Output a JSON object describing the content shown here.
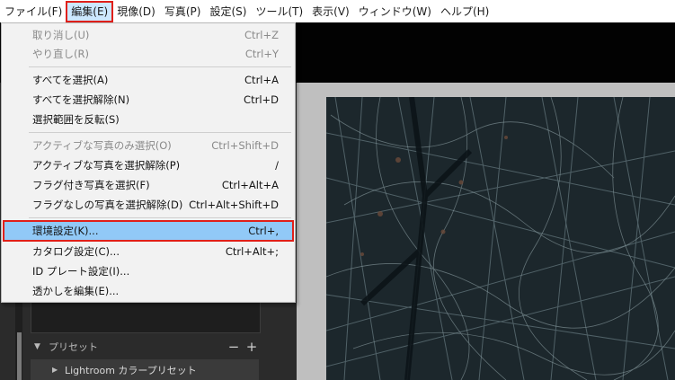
{
  "menubar": {
    "items": [
      {
        "label": "ファイル(F)"
      },
      {
        "label": "編集(E)"
      },
      {
        "label": "現像(D)"
      },
      {
        "label": "写真(P)"
      },
      {
        "label": "設定(S)"
      },
      {
        "label": "ツール(T)"
      },
      {
        "label": "表示(V)"
      },
      {
        "label": "ウィンドウ(W)"
      },
      {
        "label": "ヘルプ(H)"
      }
    ],
    "active_item": "編集(E)"
  },
  "edit_menu": {
    "groups": [
      [
        {
          "label": "取り消し(U)",
          "shortcut": "Ctrl+Z",
          "enabled": false
        },
        {
          "label": "やり直し(R)",
          "shortcut": "Ctrl+Y",
          "enabled": false
        }
      ],
      [
        {
          "label": "すべてを選択(A)",
          "shortcut": "Ctrl+A",
          "enabled": true
        },
        {
          "label": "すべてを選択解除(N)",
          "shortcut": "Ctrl+D",
          "enabled": true
        },
        {
          "label": "選択範囲を反転(S)",
          "shortcut": "",
          "enabled": true
        }
      ],
      [
        {
          "label": "アクティブな写真のみ選択(O)",
          "shortcut": "Ctrl+Shift+D",
          "enabled": false
        },
        {
          "label": "アクティブな写真を選択解除(P)",
          "shortcut": "/",
          "enabled": true
        },
        {
          "label": "フラグ付き写真を選択(F)",
          "shortcut": "Ctrl+Alt+A",
          "enabled": true
        },
        {
          "label": "フラグなしの写真を選択解除(D)",
          "shortcut": "Ctrl+Alt+Shift+D",
          "enabled": true
        }
      ],
      [
        {
          "label": "環境設定(K)...",
          "shortcut": "Ctrl+,",
          "enabled": true,
          "highlighted": true
        },
        {
          "label": "カタログ設定(C)...",
          "shortcut": "Ctrl+Alt+;",
          "enabled": true
        },
        {
          "label": "ID プレート設定(I)...",
          "shortcut": "",
          "enabled": true
        },
        {
          "label": "透かしを編集(E)...",
          "shortcut": "",
          "enabled": true
        }
      ]
    ]
  },
  "presets_panel": {
    "header": "プリセット",
    "collapse_icon": "triangle-down-icon",
    "minus_label": "−",
    "plus_label": "+",
    "folder": {
      "label": "Lightroom カラープリセット",
      "icon": "triangle-right-icon"
    }
  },
  "colors": {
    "highlight": "#91c9f7",
    "annotation_red": "#e0201a",
    "menu_background": "#f2f2f2"
  }
}
